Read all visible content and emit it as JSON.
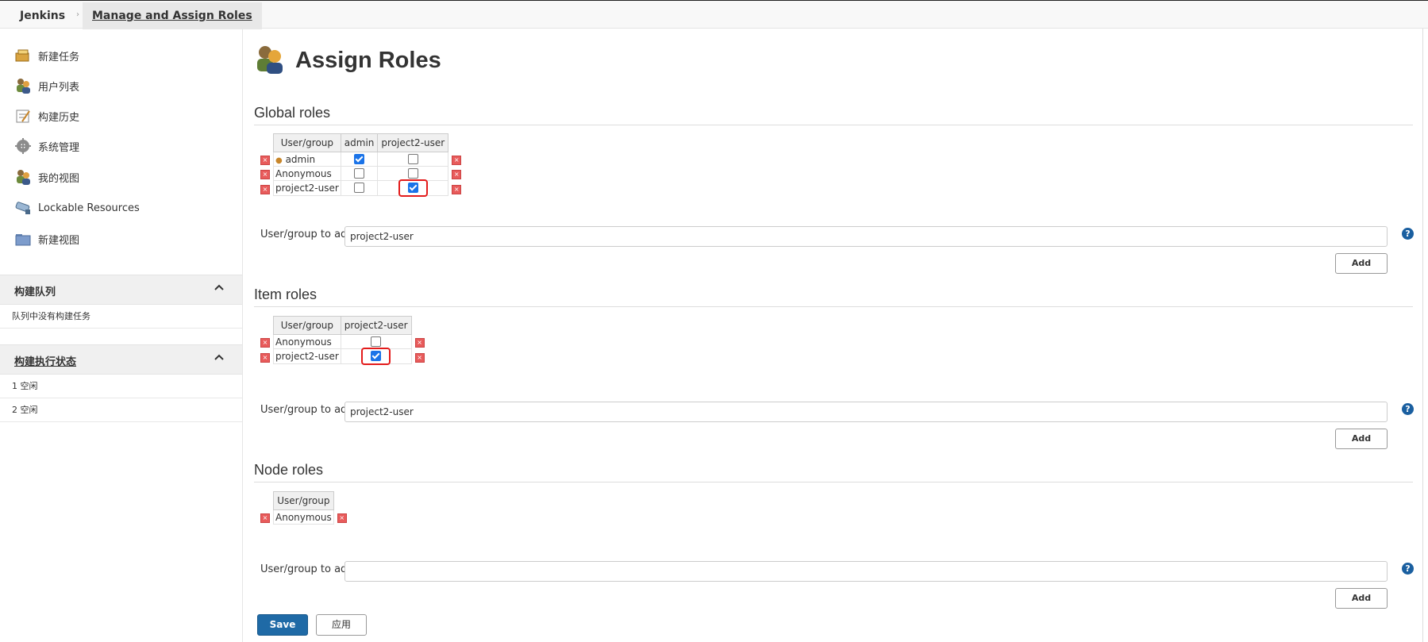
{
  "breadcrumb": {
    "home": "Jenkins",
    "current": "Manage and Assign Roles"
  },
  "sidebar": {
    "tasks": [
      {
        "label": "新建任务",
        "icon": "new-item-icon"
      },
      {
        "label": "用户列表",
        "icon": "users-icon"
      },
      {
        "label": "构建历史",
        "icon": "build-history-icon"
      },
      {
        "label": "系统管理",
        "icon": "gear-icon"
      },
      {
        "label": "我的视图",
        "icon": "my-views-icon"
      },
      {
        "label": "Lockable Resources",
        "icon": "lock-resource-icon"
      },
      {
        "label": "新建视图",
        "icon": "folder-icon"
      }
    ],
    "queue": {
      "title": "构建队列",
      "empty": "队列中没有构建任务"
    },
    "executors": {
      "title": "构建执行状态",
      "rows": [
        "1  空闲",
        "2  空闲"
      ]
    }
  },
  "main": {
    "title": "Assign Roles",
    "global": {
      "title": "Global roles",
      "header": [
        "User/group",
        "admin",
        "project2-user"
      ],
      "rows": [
        {
          "name": "admin",
          "checks": [
            true,
            false
          ]
        },
        {
          "name": "Anonymous",
          "checks": [
            false,
            false
          ]
        },
        {
          "name": "project2-user",
          "checks": [
            false,
            true
          ]
        }
      ],
      "add_label": "User/group to add",
      "add_value": "project2-user",
      "add_button": "Add"
    },
    "item": {
      "title": "Item roles",
      "header": [
        "User/group",
        "project2-user"
      ],
      "rows": [
        {
          "name": "Anonymous",
          "checks": [
            false
          ]
        },
        {
          "name": "project2-user",
          "checks": [
            true
          ]
        }
      ],
      "add_label": "User/group to add",
      "add_value": "project2-user",
      "add_button": "Add"
    },
    "node": {
      "title": "Node roles",
      "header": [
        "User/group"
      ],
      "rows": [
        {
          "name": "Anonymous"
        }
      ],
      "add_label": "User/group to add",
      "add_value": "",
      "add_button": "Add"
    },
    "save": "Save",
    "apply": "应用",
    "help": "?"
  }
}
